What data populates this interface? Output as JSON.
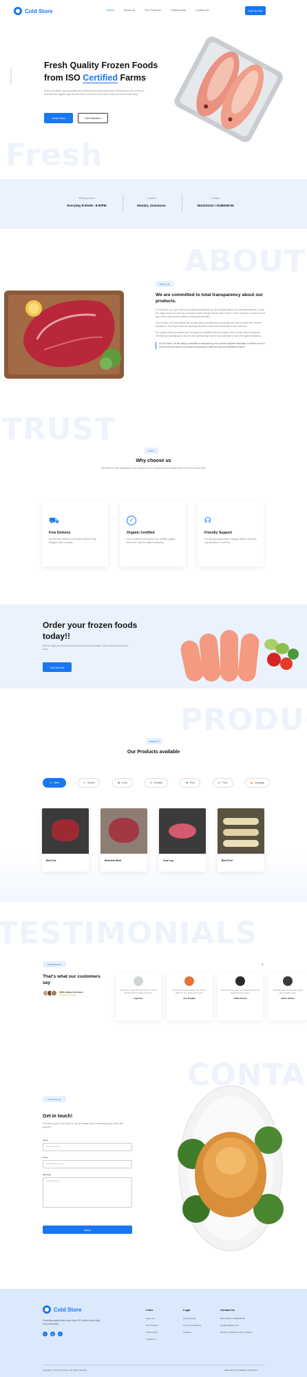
{
  "brand": {
    "name": "Cold Store"
  },
  "nav": {
    "links": [
      "Home",
      "About Us",
      "Our Products",
      "Testimonials",
      "Contact Us"
    ],
    "cta": "Call us now"
  },
  "hero": {
    "side_text": "FRESH FOOD",
    "title_line1": "Fresh Quality Frozen Foods",
    "title_line2_pre": "from ISO ",
    "title_highlight": "Certified",
    "title_line2_post": " Farms",
    "desc": "Ensure we deliver only top-quality and certified frozen foods sourced from trusted farms with a focus on freshness and hygiene right from the farm to your door. Don't wait, order your frozen foods today!",
    "btn_order": "Order Now",
    "btn_directions": "Get Direction",
    "ghost": "Fresh"
  },
  "info": [
    {
      "label": "Working Hours",
      "value": "Everyday 8:00AM - 8:00PM"
    },
    {
      "label": "Location",
      "value": "Mombo, Sowutuom"
    },
    {
      "label": "Contact",
      "value": "0541101211 / 0248028746"
    }
  ],
  "about": {
    "ghost": "ABOUT US",
    "pill": "ABOUT US",
    "title": "We are committed to total transparency about our products.",
    "p1": "At Cold Store, our core values are quality and transparency. We strongly believe our customers deserve to know the origin of their food and the processes it goes through before it gets to them. That is why every product we sell has a clear origin and is certified by independent bodies.",
    "p2": "At Cold Store, we work directly with certified farms ensuring that our products are fresh and free from harmful substances. Our frozen foods are carefully handled to retain their natural flavour and nutrients.",
    "p3": "Our quality control procedures are thorough and maintained at every stage of the process, from farming and harvesting to packaging and delivery. We continuously improve our processes to meet the highest standards.",
    "quote": "At Cold Store, we are deeply committed to transparency and provide complete information on where our food comes from and how it is processed, ensuring you make the best and healthiest choices."
  },
  "trust": {
    "ghost": "TRUST",
    "pill": "TRUST",
    "title": "Why choose us",
    "subtitle": "We believe in total transparency and making sure our customers know exactly where their food comes from.",
    "cards": [
      {
        "icon": "truck-icon",
        "title": "Free Delivery",
        "text": "We offer free delivery on all orders within the city, straight to your doorstep."
      },
      {
        "icon": "certified-icon",
        "title": "Organic Certified",
        "text": "All our products are sourced from certified organic farms and meet the highest standards."
      },
      {
        "icon": "headset-icon",
        "title": "Friendly Support",
        "text": "Our friendly support team is always ready to help with any questions or concerns."
      }
    ]
  },
  "order": {
    "title_line1": "Order your frozen foods",
    "title_line2": "today!!",
    "desc": "We'll be happy to deliver your frozen foods to your doorstep. Call us now and place your order.",
    "cta": "Call us now"
  },
  "products": {
    "ghost": "PRODUCTS",
    "pill": "PRODUCT",
    "title": "Our Products available",
    "tabs": [
      "Beef",
      "Mutton",
      "Goat",
      "Chicken",
      "Fish",
      "Pork",
      "Sausage"
    ],
    "items": [
      {
        "name": "Beef Cut"
      },
      {
        "name": "Boneless Beef"
      },
      {
        "name": "Cow Leg"
      },
      {
        "name": "Beef Feet"
      }
    ]
  },
  "testimonials": {
    "ghost": "TESTIMONIALS",
    "pill": "TESTIMONIALS",
    "title": "That's what our customers say",
    "count": "1000+ Happy Customers",
    "rating": "4.8 (2000+ reviews)",
    "items": [
      {
        "name": "Cypriano",
        "text": "I have been buying from Cold Store for months and the quality is always consistent."
      },
      {
        "name": "Ann Royalty",
        "text": "The frozen foods are always fresh and the delivery is fast. Highly recommend."
      },
      {
        "name": "Abdul Gurma",
        "text": "Great customer service and quality products. My family loves the chicken."
      },
      {
        "name": "Gloria Jumbo",
        "text": "Affordable prices and the best quality frozen foods in town."
      }
    ]
  },
  "contact": {
    "ghost": "CONTACT",
    "pill": "CONTACT US",
    "title": "Get in touch!",
    "desc": "Feel free to get in touch with us. We are always open to discussing new orders and inquiries.",
    "name_label": "Name",
    "name_ph": "Full Name Here",
    "email_label": "Email",
    "email_ph": "Email Address Here",
    "message_label": "Message",
    "message_ph": "Type Message...",
    "submit": "Send"
  },
  "footer": {
    "desc": "Providing quality frozen foods from ISO certified farms right to your doorstep.",
    "cols": [
      {
        "title": "Links",
        "items": [
          "About Us",
          "Our Products",
          "Testimonials",
          "Contact Us"
        ]
      },
      {
        "title": "Legal",
        "items": [
          "Privacy Policy",
          "Terms & Conditions",
          "Licenses"
        ]
      },
      {
        "title": "Contact Us",
        "items": [
          "0541101211 / 0248028746",
          "info@coldstore.com",
          "Mombo, Sowutuom, Accra, Ghana"
        ]
      }
    ],
    "copyright": "Copyright © 2024 Cold Store. All rights reserved.",
    "credit": "Made with ♥ by Skillbrain Studio Pro"
  },
  "colors": {
    "accent": "#1877f2",
    "light_bg": "#eaf2fd"
  }
}
